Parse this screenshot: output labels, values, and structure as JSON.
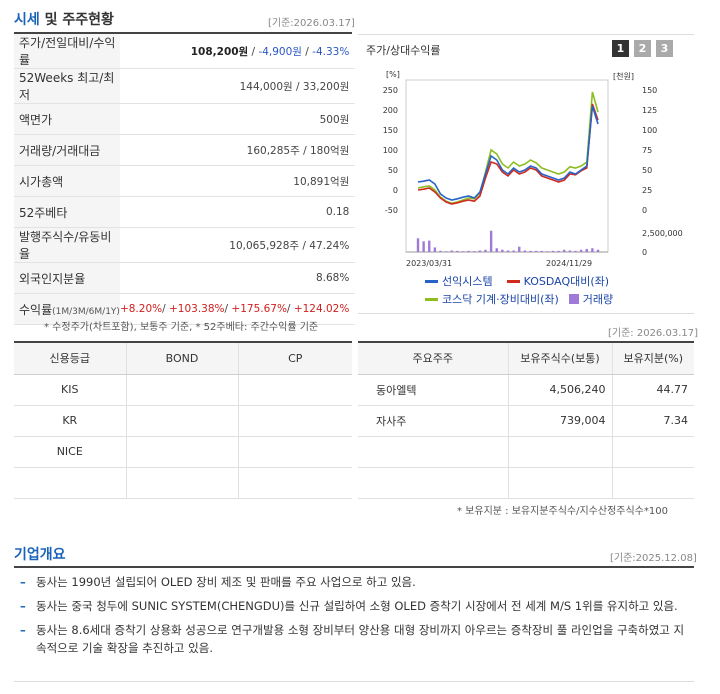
{
  "price_section": {
    "title_blue": "시세",
    "title_rest": " 및 주주현황",
    "ref_date": "[기준:2026.03.17]",
    "rows": [
      {
        "label": "주가/전일대비/수익률",
        "value_main": "108,200원",
        "sep1": " / ",
        "value_change": "-4,900원",
        "sep2": " / ",
        "value_pct": "-4.33%"
      },
      {
        "label": "52Weeks 최고/최저",
        "value": "144,000원 / 33,200원"
      },
      {
        "label": "액면가",
        "value": "500원"
      },
      {
        "label": "거래량/거래대금",
        "value": "160,285주 / 180억원"
      },
      {
        "label": "시가총액",
        "value": "10,891억원"
      },
      {
        "label": "52주베타",
        "value": "0.18"
      },
      {
        "label": "발행주식수/유동비율",
        "value": "10,065,928주 / 47.24%"
      },
      {
        "label": "외국인지분율",
        "value": "8.68%"
      },
      {
        "label": "수익률",
        "label_sub": "(1M/3M/6M/1Y)",
        "r1": "+8.20%",
        "r2": "+103.38%",
        "r3": "+175.67%",
        "r4": "+124.02%",
        "sep": "/ "
      }
    ],
    "footnote": "* 수정주가(차트포함), 보통주 기준, * 52주베타: 주간수익률 기준"
  },
  "chart_panel": {
    "title": "주가/상대수익률",
    "tabs": [
      "1",
      "2",
      "3"
    ],
    "active_tab": 0,
    "left_unit": "[%]",
    "right_unit": "[천원]",
    "volume_max_label": "2,500,000",
    "volume_zero_label": "0",
    "legend": [
      {
        "name": "선익시스템",
        "color": "#2563c9"
      },
      {
        "name": "KOSDAQ대비(좌)",
        "color": "#d02a1f"
      },
      {
        "name": "코스닥 기계·장비대비(좌)",
        "color": "#8dbd1e"
      },
      {
        "name": "거래량",
        "color": "#a07ad8"
      }
    ]
  },
  "chart_data": {
    "type": "line",
    "x_labels": [
      "2023/03/31",
      "2024/11/29"
    ],
    "left_axis": {
      "unit": "[%]",
      "ticks": [
        250,
        200,
        150,
        100,
        50,
        0,
        -50
      ],
      "ylim": [
        -50,
        250
      ]
    },
    "right_axis": {
      "unit": "[천원]",
      "ticks": [
        150,
        125,
        100,
        75,
        50,
        25,
        0
      ],
      "ylim": [
        0,
        150
      ]
    },
    "series": [
      {
        "name": "선익시스템",
        "color": "#2563c9",
        "values": [
          20,
          22,
          25,
          15,
          -10,
          -20,
          -25,
          -22,
          -18,
          -15,
          -20,
          -5,
          40,
          85,
          75,
          50,
          40,
          55,
          45,
          50,
          60,
          55,
          40,
          35,
          30,
          25,
          30,
          45,
          40,
          50,
          60,
          210,
          165
        ]
      },
      {
        "name": "KOSDAQ대비(좌)",
        "color": "#d02a1f",
        "values": [
          0,
          2,
          5,
          -5,
          -20,
          -30,
          -35,
          -32,
          -28,
          -25,
          -28,
          -15,
          30,
          70,
          65,
          45,
          35,
          50,
          40,
          45,
          55,
          50,
          35,
          30,
          25,
          20,
          25,
          40,
          38,
          48,
          55,
          215,
          175
        ]
      },
      {
        "name": "코스닥 기계·장비대비(좌)",
        "color": "#8dbd1e",
        "values": [
          5,
          8,
          10,
          0,
          -18,
          -28,
          -33,
          -30,
          -25,
          -20,
          -22,
          -8,
          45,
          100,
          90,
          65,
          55,
          70,
          60,
          65,
          75,
          68,
          55,
          50,
          45,
          40,
          45,
          58,
          55,
          60,
          70,
          245,
          195
        ]
      },
      {
        "name": "거래량",
        "color": "#a07ad8",
        "values": [
          1800000,
          1400000,
          1500000,
          600000,
          150000,
          100000,
          200000,
          150000,
          100000,
          150000,
          120000,
          200000,
          300000,
          2800000,
          500000,
          300000,
          200000,
          200000,
          700000,
          200000,
          150000,
          150000,
          150000,
          100000,
          150000,
          150000,
          300000,
          200000,
          150000,
          300000,
          400000,
          500000,
          300000
        ]
      }
    ]
  },
  "credit_table": {
    "headers": [
      "신용등급",
      "BOND",
      "CP"
    ],
    "rows": [
      [
        "KIS",
        "",
        ""
      ],
      [
        "KR",
        "",
        ""
      ],
      [
        "NICE",
        "",
        ""
      ],
      [
        "",
        "",
        ""
      ]
    ]
  },
  "holders_table": {
    "ref_date": "[기준: 2026.03.17]",
    "headers": [
      "주요주주",
      "보유주식수(보통)",
      "보유지분(%)"
    ],
    "rows": [
      [
        "동아엘텍",
        "4,506,240",
        "44.77"
      ],
      [
        "자사주",
        "739,004",
        "7.34"
      ],
      [
        "",
        "",
        ""
      ],
      [
        "",
        "",
        ""
      ]
    ],
    "footnote": "* 보유지분 : 보유지분주식수/지수산정주식수*100"
  },
  "overview": {
    "title": "기업개요",
    "ref_date": "[기준:2025.12.08]",
    "bullet": "–",
    "items": [
      "동사는 1990년 설립되어 OLED 장비 제조 및 판매를 주요 사업으로 하고 있음.",
      "동사는 중국 청두에 SUNIC SYSTEM(CHENGDU)를 신규 설립하여 소형 OLED 증착기 시장에서 전 세계 M/S 1위를 유지하고 있음.",
      "동사는 8.6세대 증착기 상용화 성공으로 연구개발용 소형 장비부터 양산용 대형 장비까지 아우르는 증착장비 풀 라인업을 구축하였고 지속적으로 기술 확장을 추진하고 있음."
    ]
  }
}
